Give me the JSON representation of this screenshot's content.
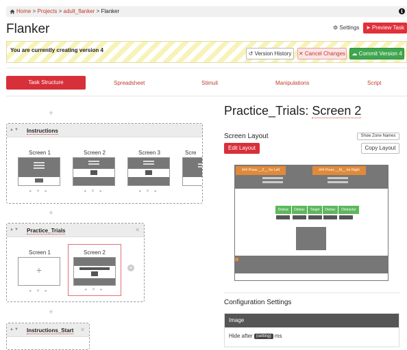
{
  "breadcrumb": {
    "home": "Home",
    "projects": "Projects",
    "project": "adult_flanker",
    "current": "Flanker",
    "sep": ">"
  },
  "header": {
    "title": "Flanker",
    "settings_label": "Settings",
    "preview_label": "Preview Task"
  },
  "banner": {
    "message": "You are currently creating version 4",
    "history_label": "Version History",
    "cancel_label": "Cancel Changes",
    "commit_label": "Commit Version 4"
  },
  "tabs": [
    {
      "label": "Task Structure",
      "active": true
    },
    {
      "label": "Spreadsheet"
    },
    {
      "label": "Stimuli"
    },
    {
      "label": "Manipulations"
    },
    {
      "label": "Script"
    }
  ],
  "groups": [
    {
      "name": "Instructions",
      "screens": [
        "Screen 1",
        "Screen 2",
        "Screen 3",
        "Scre"
      ]
    },
    {
      "name": "Practice_Trials",
      "screens": [
        "Screen 1",
        "Screen 2"
      ]
    },
    {
      "name": "Instructions_Start",
      "screens": []
    }
  ],
  "detail": {
    "title_a": "Practice_Trials:",
    "title_b": "Screen 2",
    "layout_heading": "Screen Layout",
    "show_zone_label": "Show Zone Names",
    "edit_layout_label": "Edit Layout",
    "copy_layout_label": "Copy Layout",
    "zone_left_text": "### Press __Z__ for Left",
    "zone_right_text": "### Press __M__ for Right",
    "stimulus_zones": [
      "Distrac",
      "Distrac",
      "Target",
      "Distrac",
      "Distractor"
    ],
    "config_heading": "Configuration Settings",
    "config_section": "Image",
    "config_hide_prefix": "Hide after",
    "config_setting_chip": "(setting)",
    "config_hide_unit": "ms"
  },
  "colors": {
    "brand": "#d7303a",
    "commit": "#3ea64f",
    "zone_orange": "#e08a3a",
    "zone_green": "#5cb85c"
  }
}
